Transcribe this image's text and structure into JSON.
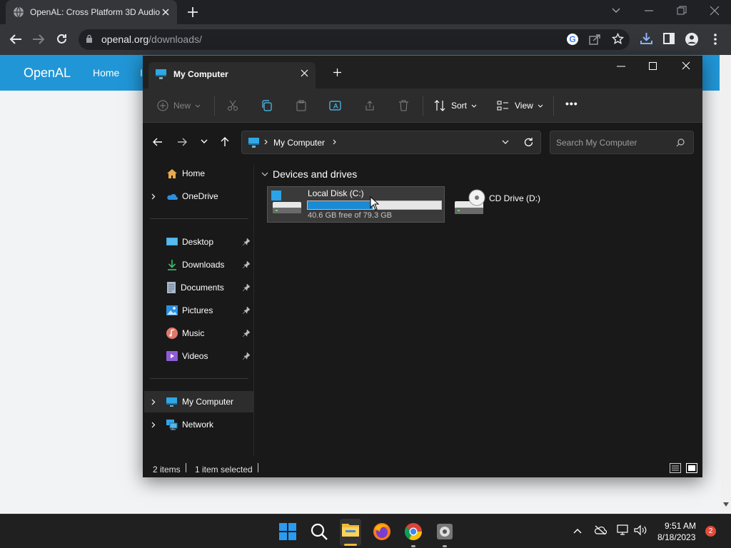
{
  "browser": {
    "tab_title": "OpenAL: Cross Platform 3D Audio",
    "url_host": "openal.org",
    "url_path": "/downloads/"
  },
  "website": {
    "logo": "OpenAL",
    "nav_home": "Home",
    "nav_partial": "I"
  },
  "explorer": {
    "tab_title": "My Computer",
    "toolbar": {
      "new": "New",
      "sort": "Sort",
      "view": "View",
      "more": "•••"
    },
    "breadcrumb": "My Computer",
    "search_placeholder": "Search My Computer",
    "nav": {
      "top": [
        {
          "label": "Home",
          "icon": "home-icon"
        },
        {
          "label": "OneDrive",
          "icon": "onedrive-icon"
        }
      ],
      "pinned": [
        {
          "label": "Desktop",
          "icon": "desktop-icon"
        },
        {
          "label": "Downloads",
          "icon": "downloads-icon"
        },
        {
          "label": "Documents",
          "icon": "documents-icon"
        },
        {
          "label": "Pictures",
          "icon": "pictures-icon"
        },
        {
          "label": "Music",
          "icon": "music-icon"
        },
        {
          "label": "Videos",
          "icon": "videos-icon"
        }
      ],
      "bottom": [
        {
          "label": "My Computer",
          "icon": "computer-icon",
          "selected": true
        },
        {
          "label": "Network",
          "icon": "network-icon"
        }
      ]
    },
    "section_title": "Devices and drives",
    "drives": [
      {
        "name": "Local Disk (C:)",
        "free_text": "40.6 GB free of 79.3 GB",
        "used_fraction": 0.488,
        "selected": true
      },
      {
        "name": "CD Drive (D:)"
      }
    ],
    "status": {
      "items": "2 items",
      "selected": "1 item selected"
    }
  },
  "taskbar": {
    "time": "9:51 AM",
    "date": "8/18/2023",
    "notifications": "2"
  },
  "colors": {
    "accent": "#2196d6",
    "drive_bar": "#1a8ad4",
    "selection": "#3a3a3a"
  }
}
